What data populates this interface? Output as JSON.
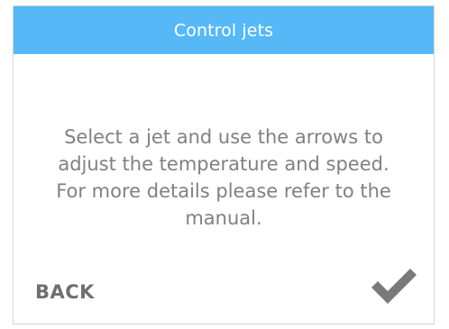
{
  "dialog": {
    "title": "Control jets",
    "message": "Select a jet and use the arrows to adjust the temperature and speed. For more details please refer to the manual.",
    "back_label": "BACK",
    "confirm_icon": "checkmark-icon"
  },
  "colors": {
    "header_bg": "#56b8f6",
    "header_text": "#ffffff",
    "body_text": "#808080",
    "action_text": "#6f6f6f"
  }
}
